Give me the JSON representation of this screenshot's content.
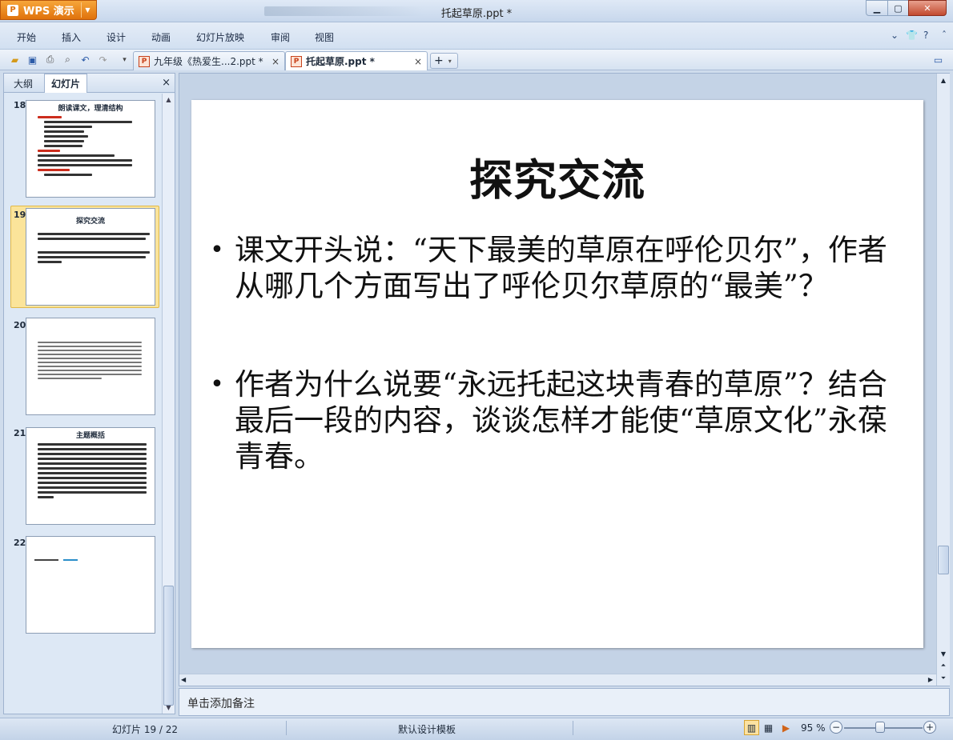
{
  "titlebar": {
    "app_button": "WPS 演示",
    "doc_title": "托起草原.ppt *",
    "minimize": "▁",
    "maximize": "▢",
    "close": "✕"
  },
  "menu": {
    "items": [
      "开始",
      "插入",
      "设计",
      "动画",
      "幻灯片放映",
      "审阅",
      "视图"
    ]
  },
  "toolbar": {
    "tabs": [
      {
        "label": "九年级《热爱生...2.ppt *",
        "active": false
      },
      {
        "label": "托起草原.ppt *",
        "active": true
      }
    ],
    "tab_close": "×",
    "new_tab": "+"
  },
  "left_panel": {
    "tabs": [
      "大纲",
      "幻灯片"
    ],
    "active_tab": "幻灯片",
    "close": "×",
    "slides": [
      {
        "number": "18",
        "title": "朗读课文，理清结构"
      },
      {
        "number": "19",
        "title": "探究交流",
        "selected": true
      },
      {
        "number": "20",
        "title": ""
      },
      {
        "number": "21",
        "title": "主题概括"
      },
      {
        "number": "22",
        "title": ""
      }
    ]
  },
  "slide": {
    "title": "探究交流",
    "bullets": [
      "课文开头说：“天下最美的草原在呼伦贝尔”，作者从哪几个方面写出了呼伦贝尔草原的“最美”？",
      "作者为什么说要“永远托起这块青春的草原”？结合最后一段的内容，谈谈怎样才能使“草原文化”永葆青春。"
    ],
    "bullet_glyph": "•"
  },
  "notes": {
    "placeholder": "单击添加备注"
  },
  "status": {
    "slide_counter": "幻灯片 19 / 22",
    "template": "默认设计模板",
    "zoom": "95 %"
  }
}
